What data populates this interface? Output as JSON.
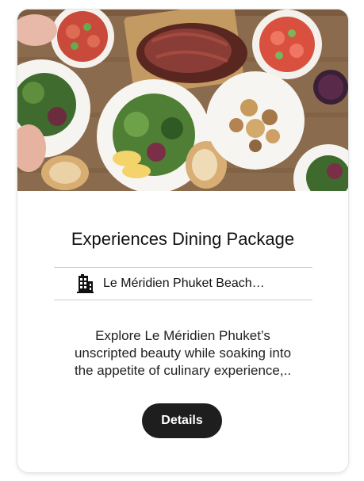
{
  "card": {
    "image_alt": "Dining table with plates of salad, roast beef, mushrooms and bread",
    "title": "Experiences Dining Package",
    "hotel_icon": "building-icon",
    "hotel_name": "Le Méridien Phuket Beach…",
    "description_lines": [
      "Explore Le Méridien Phuket’s",
      "unscripted beauty while soaking into",
      "the appetite of culinary experience,.."
    ],
    "button_label": "Details"
  },
  "colors": {
    "button_bg": "#1e1e1e",
    "button_text": "#ffffff",
    "divider": "#cfcfcf"
  }
}
